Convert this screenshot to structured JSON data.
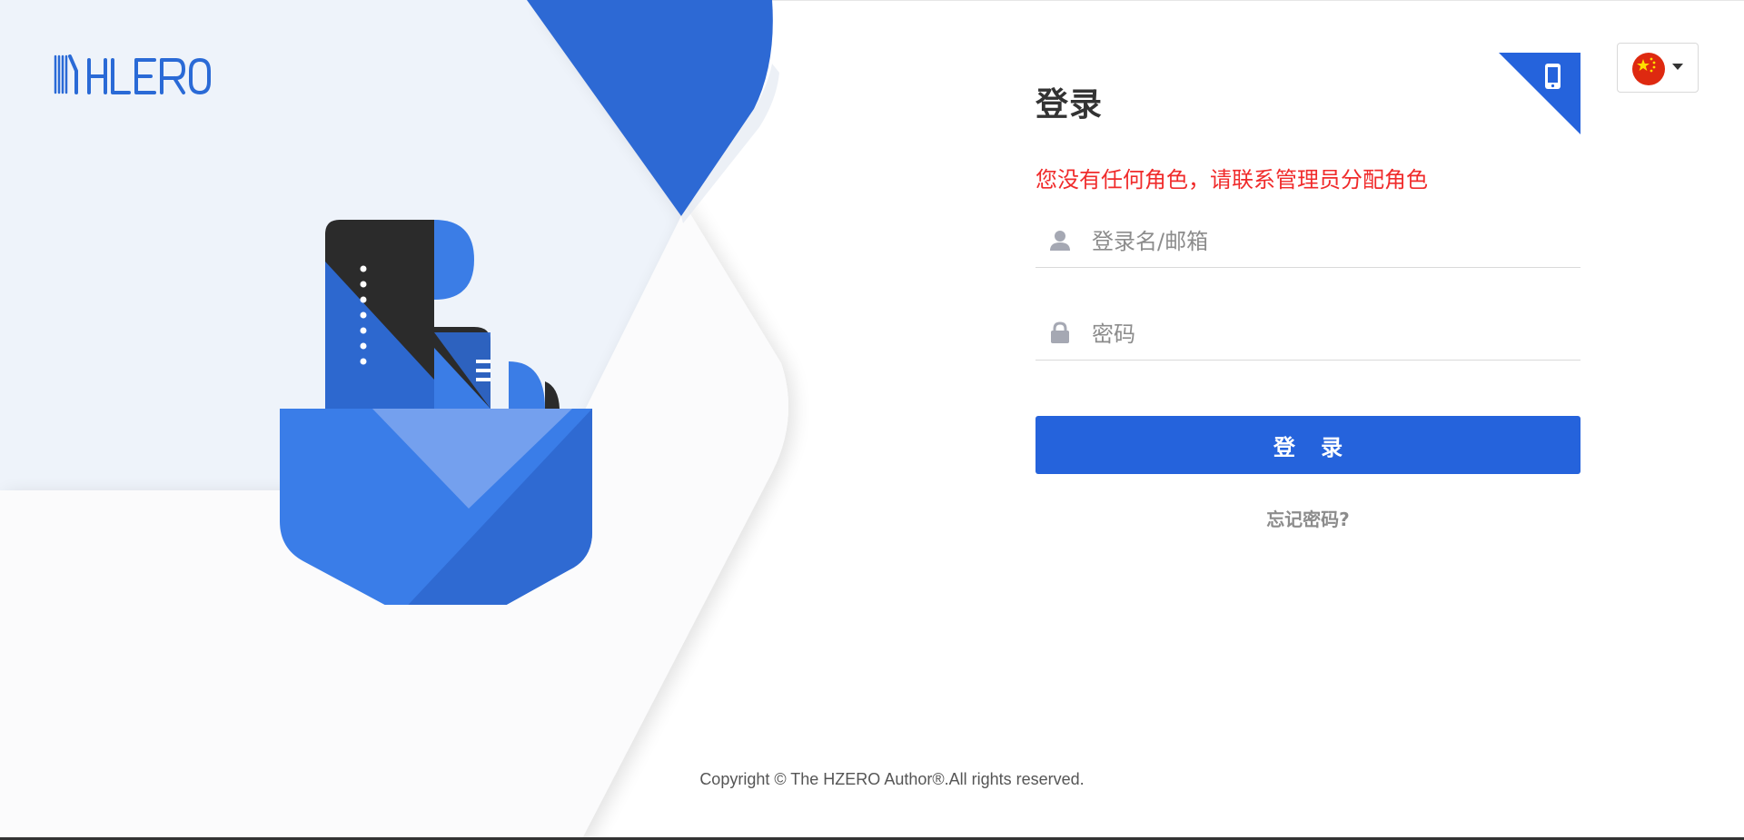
{
  "login": {
    "title": "登录",
    "error_message": "您没有任何角色，请联系管理员分配角色",
    "username_placeholder": "登录名/邮箱",
    "password_placeholder": "密码",
    "submit_label": "登 录",
    "forgot_password": "忘记密码?"
  },
  "header": {
    "logo_text": "HZERO",
    "language": "zh_CN",
    "language_flag_icon": "china-flag-icon",
    "mobile_login_icon": "mobile-phone-icon"
  },
  "footer": {
    "copyright": "Copyright © The HZERO Author®.All rights reserved."
  },
  "colors": {
    "brand_blue": "#2563dc",
    "error_red": "#f02b2b"
  }
}
